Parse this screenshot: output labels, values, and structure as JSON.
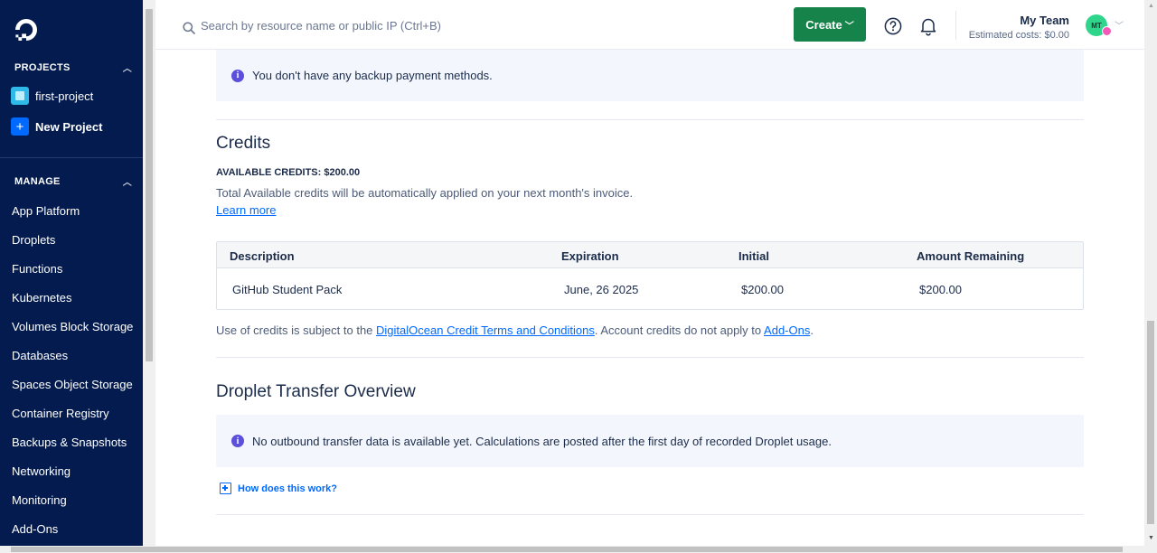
{
  "sidebar": {
    "projects_heading": "PROJECTS",
    "projects": [
      {
        "label": "first-project",
        "icon": "project-square-icon"
      },
      {
        "label": "New Project",
        "icon": "plus-icon"
      }
    ],
    "manage_heading": "MANAGE",
    "nav_items": [
      "App Platform",
      "Droplets",
      "Functions",
      "Kubernetes",
      "Volumes Block Storage",
      "Databases",
      "Spaces Object Storage",
      "Container Registry",
      "Backups & Snapshots",
      "Networking",
      "Monitoring",
      "Add-Ons"
    ]
  },
  "topbar": {
    "search_placeholder": "Search by resource name or public IP (Ctrl+B)",
    "create_label": "Create",
    "team_name": "My Team",
    "estimated_costs": "Estimated costs: $0.00",
    "avatar_initials": "MT"
  },
  "backup": {
    "message": "You don't have any backup payment methods."
  },
  "credits": {
    "title": "Credits",
    "available": "AVAILABLE CREDITS: $200.00",
    "description": "Total Available credits will be automatically applied on your next month's invoice.",
    "learn_more": "Learn more",
    "table": {
      "headers": [
        "Description",
        "Expiration",
        "Initial",
        "Amount Remaining"
      ],
      "rows": [
        [
          "GitHub Student Pack",
          "June, 26 2025",
          "$200.00",
          "$200.00"
        ]
      ]
    },
    "terms_prefix": "Use of credits is subject to the ",
    "terms_link": "DigitalOcean Credit Terms and Conditions",
    "terms_middle": ". Account credits do not apply to ",
    "addons_link": "Add-Ons",
    "terms_suffix": "."
  },
  "transfer": {
    "title": "Droplet Transfer Overview",
    "message": "No outbound transfer data is available yet. Calculations are posted after the first day of recorded Droplet usage.",
    "how_link": "How does this work?"
  },
  "colors": {
    "sidebar_bg": "#031b4e",
    "create_button": "#15834a",
    "link": "#0069ff",
    "info_icon": "#5b4fdb",
    "info_box_bg": "#f3f7fd"
  }
}
